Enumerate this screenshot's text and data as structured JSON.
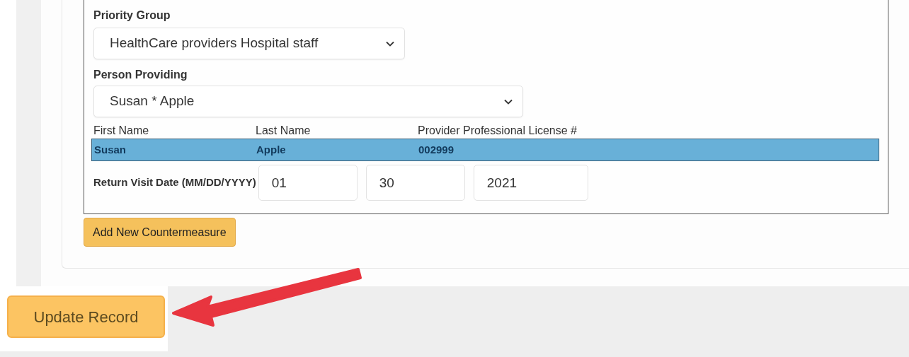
{
  "priority_group": {
    "label": "Priority Group",
    "value": "HealthCare providers Hospital staff"
  },
  "person_providing": {
    "label": "Person Providing",
    "value": "Susan * Apple"
  },
  "providers_table": {
    "columns": [
      "First Name",
      "Last Name",
      "Provider Professional License #"
    ],
    "rows": [
      {
        "cells": [
          "Susan",
          "Apple",
          "002999"
        ],
        "selected": true
      }
    ]
  },
  "return_visit_date": {
    "label": "Return Visit Date (MM/DD/YYYY)",
    "month": "01",
    "day": "30",
    "year": "2021"
  },
  "add_button": {
    "label": "Add New Countermeasure"
  },
  "update_button": {
    "label": "Update Record"
  }
}
